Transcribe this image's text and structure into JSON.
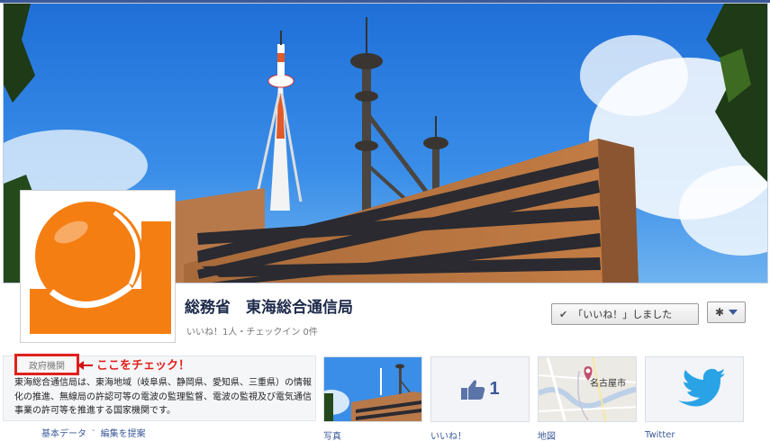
{
  "page": {
    "name": "総務省　東海総合通信局",
    "stats": "いいね！1人・チェックイン 0件"
  },
  "actions": {
    "like_button_label": "「いいね！」しました",
    "like_check_icon": "check-icon",
    "settings_icon": "gear-icon"
  },
  "about": {
    "category": "政府機関",
    "callout": "ここをチェック！",
    "description": "東海総合通信局は、東海地域（岐阜県、静岡県、愛知県、三重県）の情報化の推進、無線局の許認可等の電波の監理監督、電波の監視及び電気通信事業の許可等を推進する国家機関です。",
    "link_basic_data": "基本データ",
    "link_separator": "-",
    "link_suggest_edit": "編集を提案"
  },
  "tiles": [
    {
      "label": "写真",
      "icon": "photo-thumbnail"
    },
    {
      "label": "いいね！",
      "icon": "thumbs-up-icon",
      "count": "1"
    },
    {
      "label": "地図",
      "icon": "map-thumbnail",
      "map_city": "名古屋市"
    },
    {
      "label": "Twitter",
      "icon": "twitter-bird-icon"
    }
  ],
  "colors": {
    "facebook_blue": "#3b5998",
    "callout_red": "#e0211c",
    "logo_orange": "#f57e12"
  }
}
